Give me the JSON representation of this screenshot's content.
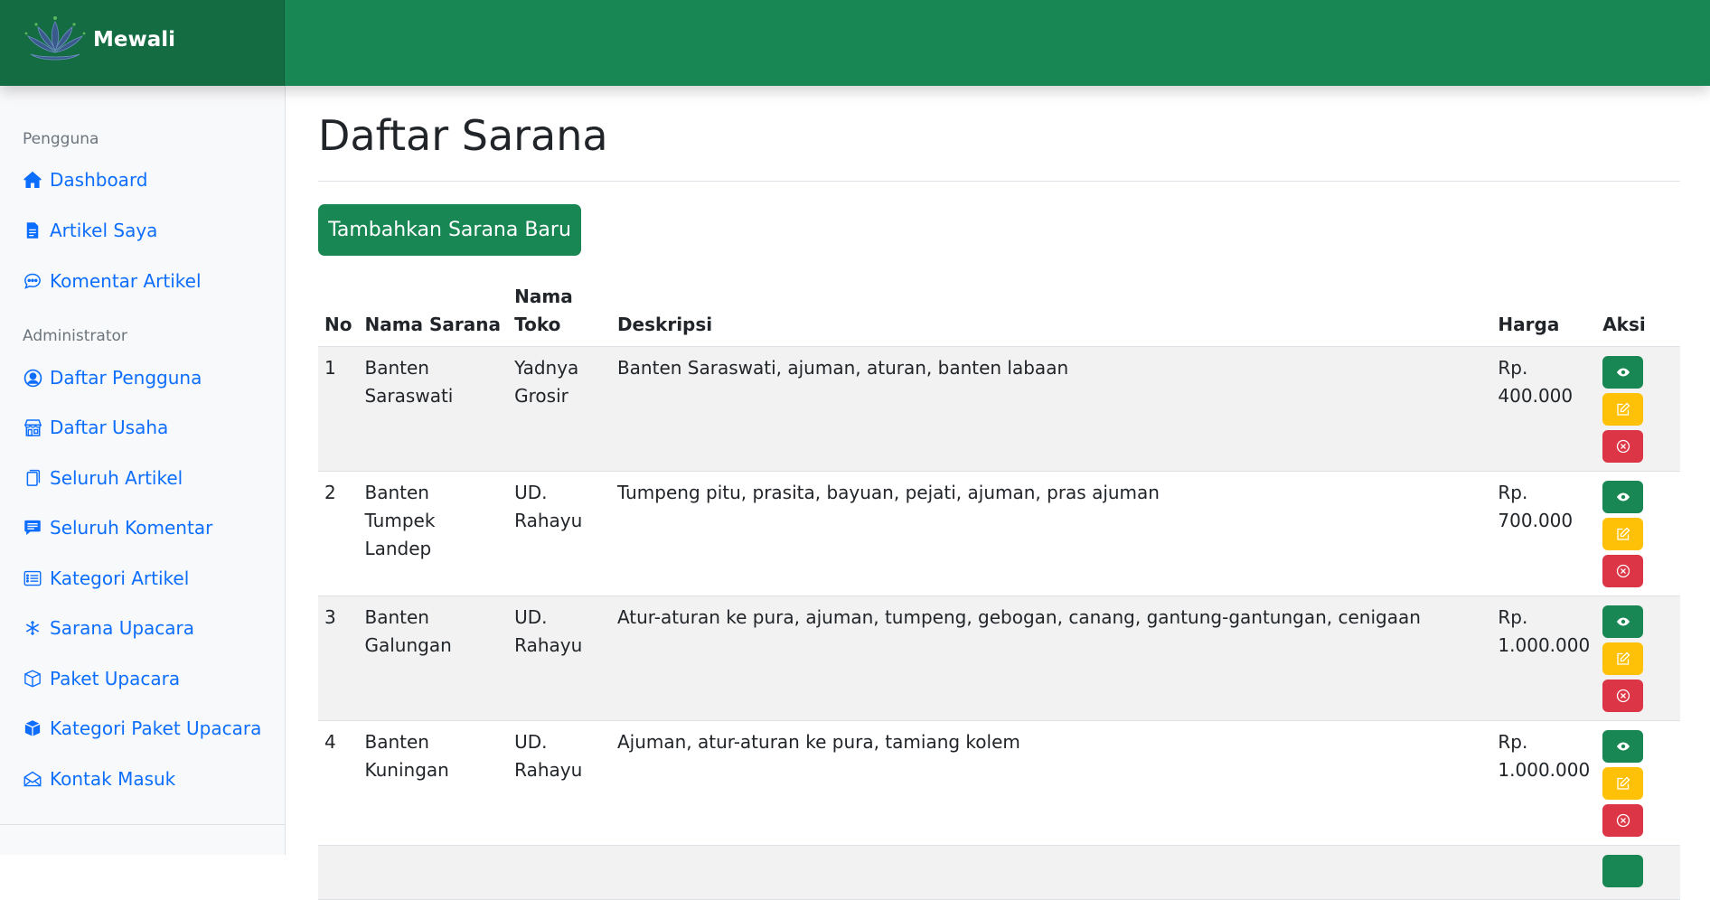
{
  "app": {
    "brand": "Mewali"
  },
  "sidebar": {
    "sections": [
      {
        "heading": "Pengguna",
        "items": [
          {
            "label": "Dashboard",
            "icon": "house-icon"
          },
          {
            "label": "Artikel Saya",
            "icon": "file-icon"
          },
          {
            "label": "Komentar Artikel",
            "icon": "chat-dots-icon"
          }
        ]
      },
      {
        "heading": "Administrator",
        "items": [
          {
            "label": "Daftar Pengguna",
            "icon": "person-circle-icon"
          },
          {
            "label": "Daftar Usaha",
            "icon": "shop-icon"
          },
          {
            "label": "Seluruh Artikel",
            "icon": "files-icon"
          },
          {
            "label": "Seluruh Komentar",
            "icon": "chat-text-icon"
          },
          {
            "label": "Kategori Artikel",
            "icon": "list-icon"
          },
          {
            "label": "Sarana Upacara",
            "icon": "snowflake-icon"
          },
          {
            "label": "Paket Upacara",
            "icon": "box-icon"
          },
          {
            "label": "Kategori Paket Upacara",
            "icon": "box-filled-icon"
          },
          {
            "label": "Kontak Masuk",
            "icon": "envelope-open-icon"
          }
        ]
      }
    ]
  },
  "main": {
    "title": "Daftar Sarana",
    "add_button": "Tambahkan Sarana Baru",
    "table": {
      "headers": {
        "no": "No",
        "nama": "Nama Sarana",
        "toko": "Nama Toko",
        "deskripsi": "Deskripsi",
        "harga": "Harga",
        "aksi": "Aksi"
      },
      "rows": [
        {
          "no": "1",
          "nama": "Banten Saraswati",
          "toko": "Yadnya Grosir",
          "deskripsi": "Banten Saraswati, ajuman, aturan, banten labaan",
          "harga": "Rp. 400.000"
        },
        {
          "no": "2",
          "nama": "Banten Tumpek Landep",
          "toko": "UD. Rahayu",
          "deskripsi": "Tumpeng pitu, prasita, bayuan, pejati, ajuman, pras ajuman",
          "harga": "Rp. 700.000"
        },
        {
          "no": "3",
          "nama": "Banten Galungan",
          "toko": "UD. Rahayu",
          "deskripsi": "Atur-aturan ke pura, ajuman, tumpeng, gebogan, canang, gantung-gantungan, cenigaan",
          "harga": "Rp. 1.000.000"
        },
        {
          "no": "4",
          "nama": "Banten Kuningan",
          "toko": "UD. Rahayu",
          "deskripsi": "Ajuman, atur-aturan ke pura, tamiang kolem",
          "harga": "Rp. 1.000.000"
        }
      ]
    }
  },
  "colors": {
    "primary_green": "#198754",
    "brand_dark": "#146c43",
    "link_blue": "#0d6efd",
    "warning": "#ffc107",
    "danger": "#dc3545"
  }
}
